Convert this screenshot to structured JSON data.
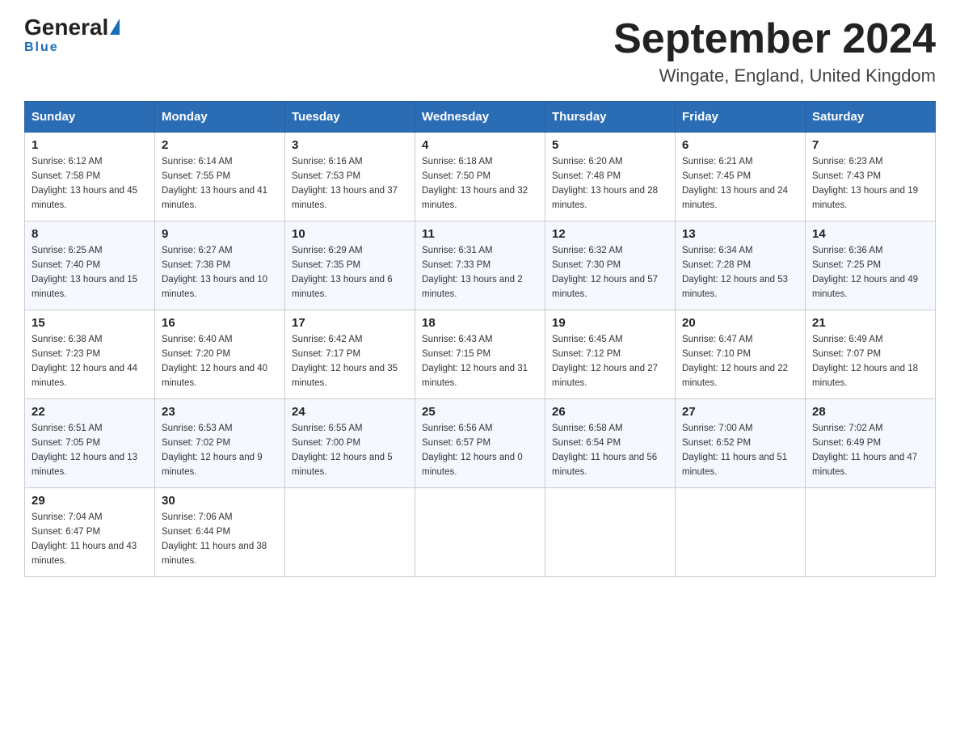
{
  "header": {
    "logo": {
      "general": "General",
      "blue": "Blue",
      "underline": "Blue"
    },
    "title": "September 2024",
    "location": "Wingate, England, United Kingdom"
  },
  "days_of_week": [
    "Sunday",
    "Monday",
    "Tuesday",
    "Wednesday",
    "Thursday",
    "Friday",
    "Saturday"
  ],
  "weeks": [
    [
      {
        "day": "1",
        "sunrise": "6:12 AM",
        "sunset": "7:58 PM",
        "daylight": "13 hours and 45 minutes."
      },
      {
        "day": "2",
        "sunrise": "6:14 AM",
        "sunset": "7:55 PM",
        "daylight": "13 hours and 41 minutes."
      },
      {
        "day": "3",
        "sunrise": "6:16 AM",
        "sunset": "7:53 PM",
        "daylight": "13 hours and 37 minutes."
      },
      {
        "day": "4",
        "sunrise": "6:18 AM",
        "sunset": "7:50 PM",
        "daylight": "13 hours and 32 minutes."
      },
      {
        "day": "5",
        "sunrise": "6:20 AM",
        "sunset": "7:48 PM",
        "daylight": "13 hours and 28 minutes."
      },
      {
        "day": "6",
        "sunrise": "6:21 AM",
        "sunset": "7:45 PM",
        "daylight": "13 hours and 24 minutes."
      },
      {
        "day": "7",
        "sunrise": "6:23 AM",
        "sunset": "7:43 PM",
        "daylight": "13 hours and 19 minutes."
      }
    ],
    [
      {
        "day": "8",
        "sunrise": "6:25 AM",
        "sunset": "7:40 PM",
        "daylight": "13 hours and 15 minutes."
      },
      {
        "day": "9",
        "sunrise": "6:27 AM",
        "sunset": "7:38 PM",
        "daylight": "13 hours and 10 minutes."
      },
      {
        "day": "10",
        "sunrise": "6:29 AM",
        "sunset": "7:35 PM",
        "daylight": "13 hours and 6 minutes."
      },
      {
        "day": "11",
        "sunrise": "6:31 AM",
        "sunset": "7:33 PM",
        "daylight": "13 hours and 2 minutes."
      },
      {
        "day": "12",
        "sunrise": "6:32 AM",
        "sunset": "7:30 PM",
        "daylight": "12 hours and 57 minutes."
      },
      {
        "day": "13",
        "sunrise": "6:34 AM",
        "sunset": "7:28 PM",
        "daylight": "12 hours and 53 minutes."
      },
      {
        "day": "14",
        "sunrise": "6:36 AM",
        "sunset": "7:25 PM",
        "daylight": "12 hours and 49 minutes."
      }
    ],
    [
      {
        "day": "15",
        "sunrise": "6:38 AM",
        "sunset": "7:23 PM",
        "daylight": "12 hours and 44 minutes."
      },
      {
        "day": "16",
        "sunrise": "6:40 AM",
        "sunset": "7:20 PM",
        "daylight": "12 hours and 40 minutes."
      },
      {
        "day": "17",
        "sunrise": "6:42 AM",
        "sunset": "7:17 PM",
        "daylight": "12 hours and 35 minutes."
      },
      {
        "day": "18",
        "sunrise": "6:43 AM",
        "sunset": "7:15 PM",
        "daylight": "12 hours and 31 minutes."
      },
      {
        "day": "19",
        "sunrise": "6:45 AM",
        "sunset": "7:12 PM",
        "daylight": "12 hours and 27 minutes."
      },
      {
        "day": "20",
        "sunrise": "6:47 AM",
        "sunset": "7:10 PM",
        "daylight": "12 hours and 22 minutes."
      },
      {
        "day": "21",
        "sunrise": "6:49 AM",
        "sunset": "7:07 PM",
        "daylight": "12 hours and 18 minutes."
      }
    ],
    [
      {
        "day": "22",
        "sunrise": "6:51 AM",
        "sunset": "7:05 PM",
        "daylight": "12 hours and 13 minutes."
      },
      {
        "day": "23",
        "sunrise": "6:53 AM",
        "sunset": "7:02 PM",
        "daylight": "12 hours and 9 minutes."
      },
      {
        "day": "24",
        "sunrise": "6:55 AM",
        "sunset": "7:00 PM",
        "daylight": "12 hours and 5 minutes."
      },
      {
        "day": "25",
        "sunrise": "6:56 AM",
        "sunset": "6:57 PM",
        "daylight": "12 hours and 0 minutes."
      },
      {
        "day": "26",
        "sunrise": "6:58 AM",
        "sunset": "6:54 PM",
        "daylight": "11 hours and 56 minutes."
      },
      {
        "day": "27",
        "sunrise": "7:00 AM",
        "sunset": "6:52 PM",
        "daylight": "11 hours and 51 minutes."
      },
      {
        "day": "28",
        "sunrise": "7:02 AM",
        "sunset": "6:49 PM",
        "daylight": "11 hours and 47 minutes."
      }
    ],
    [
      {
        "day": "29",
        "sunrise": "7:04 AM",
        "sunset": "6:47 PM",
        "daylight": "11 hours and 43 minutes."
      },
      {
        "day": "30",
        "sunrise": "7:06 AM",
        "sunset": "6:44 PM",
        "daylight": "11 hours and 38 minutes."
      },
      null,
      null,
      null,
      null,
      null
    ]
  ]
}
